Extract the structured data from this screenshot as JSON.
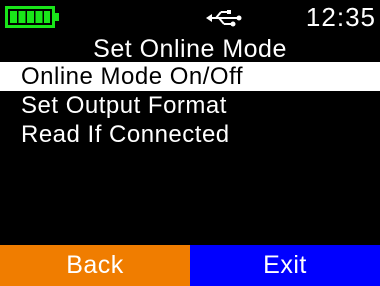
{
  "status": {
    "battery_icon": "battery-full-icon",
    "battery_color": "#19e619",
    "usb_icon": "usb-icon",
    "time": "12:35"
  },
  "header": {
    "title": "Set Online Mode"
  },
  "menu": {
    "items": [
      {
        "label": "Online Mode On/Off",
        "selected": true
      },
      {
        "label": "Set Output Format",
        "selected": false
      },
      {
        "label": "Read If Connected",
        "selected": false
      }
    ]
  },
  "softkeys": {
    "left_label": "Back",
    "left_color": "#f07d00",
    "right_label": "Exit",
    "right_color": "#0000ff"
  }
}
